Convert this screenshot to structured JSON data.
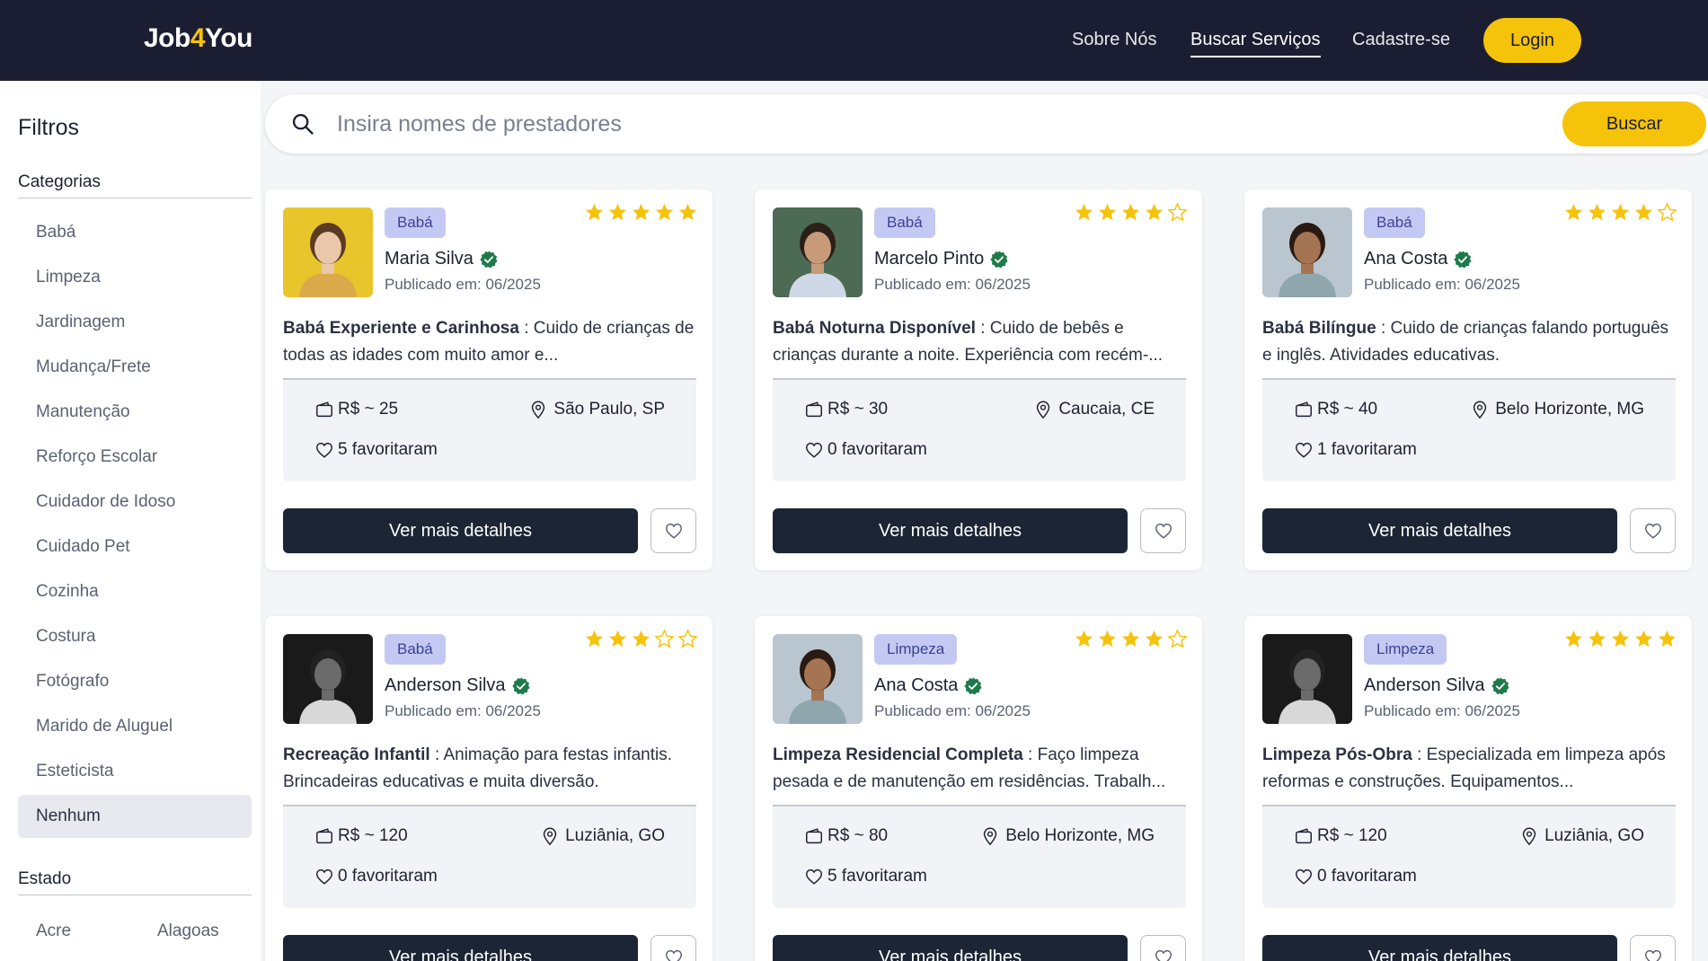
{
  "header": {
    "logo_prefix": "Job",
    "logo_four": "4",
    "logo_suffix": "You",
    "nav": [
      "Sobre Nós",
      "Buscar Serviços",
      "Cadastre-se"
    ],
    "nav_active": "Buscar Serviços",
    "login_label": "Login"
  },
  "sidebar": {
    "title": "Filtros",
    "categories_title": "Categorias",
    "categories": [
      "Babá",
      "Limpeza",
      "Jardinagem",
      "Mudança/Frete",
      "Manutenção",
      "Reforço Escolar",
      "Cuidador de Idoso",
      "Cuidado Pet",
      "Cozinha",
      "Costura",
      "Fotógrafo",
      "Marido de Aluguel",
      "Esteticista",
      "Nenhum"
    ],
    "selected_category": "Nenhum",
    "state_title": "Estado",
    "states": [
      "Acre",
      "Alagoas"
    ]
  },
  "search": {
    "placeholder": "Insira nomes de prestadores",
    "button_label": "Buscar"
  },
  "colors": {
    "header_bg": "#1b1e32",
    "accent_yellow": "#f6c30b",
    "badge_bg": "#c4c9f4",
    "button_dark": "#1b2535",
    "verified_green": "#1f7a4a",
    "star_gold": "#f6c30b"
  },
  "cards": [
    {
      "badge": "Babá",
      "rating": 5,
      "name": "Maria Silva",
      "published": "Publicado em: 06/2025",
      "title": "Babá Experiente e Carinhosa",
      "desc": " : Cuido de crianças de todas as idades com muito amor e...",
      "price": "R$ ~ 25",
      "location": "São Paulo, SP",
      "favorites": "5 favoritaram",
      "details_label": "Ver mais detalhes",
      "avatar_style": "woman-yellow"
    },
    {
      "badge": "Babá",
      "rating": 4,
      "name": "Marcelo Pinto",
      "published": "Publicado em: 06/2025",
      "title": "Babá Noturna Disponível",
      "desc": " : Cuido de bebês e crianças durante a noite. Experiência com recém-...",
      "price": "R$ ~ 30",
      "location": "Caucaia, CE",
      "favorites": "0 favoritaram",
      "details_label": "Ver mais detalhes",
      "avatar_style": "man-street"
    },
    {
      "badge": "Babá",
      "rating": 4,
      "name": "Ana Costa",
      "published": "Publicado em: 06/2025",
      "title": "Babá Bilíngue",
      "desc": " : Cuido de crianças falando português e inglês. Atividades educativas.",
      "price": "R$ ~ 40",
      "location": "Belo Horizonte, MG",
      "favorites": "1 favoritaram",
      "details_label": "Ver mais detalhes",
      "avatar_style": "woman-city"
    },
    {
      "badge": "Babá",
      "rating": 3,
      "name": "Anderson Silva",
      "published": "Publicado em: 06/2025",
      "title": "Recreação Infantil",
      "desc": " : Animação para festas infantis. Brincadeiras educativas e muita diversão.",
      "price": "R$ ~ 120",
      "location": "Luziânia, GO",
      "favorites": "0 favoritaram",
      "details_label": "Ver mais detalhes",
      "avatar_style": "man-bw"
    },
    {
      "badge": "Limpeza",
      "rating": 4,
      "name": "Ana Costa",
      "published": "Publicado em: 06/2025",
      "title": "Limpeza Residencial Completa",
      "desc": " : Faço limpeza pesada e de manutenção em residências. Trabalh...",
      "price": "R$ ~ 80",
      "location": "Belo Horizonte, MG",
      "favorites": "5 favoritaram",
      "details_label": "Ver mais detalhes",
      "avatar_style": "woman-city"
    },
    {
      "badge": "Limpeza",
      "rating": 5,
      "name": "Anderson Silva",
      "published": "Publicado em: 06/2025",
      "title": "Limpeza Pós-Obra",
      "desc": " : Especializada em limpeza após reformas e construções. Equipamentos...",
      "price": "R$ ~ 120",
      "location": "Luziânia, GO",
      "favorites": "0 favoritaram",
      "details_label": "Ver mais detalhes",
      "avatar_style": "man-bw"
    }
  ]
}
